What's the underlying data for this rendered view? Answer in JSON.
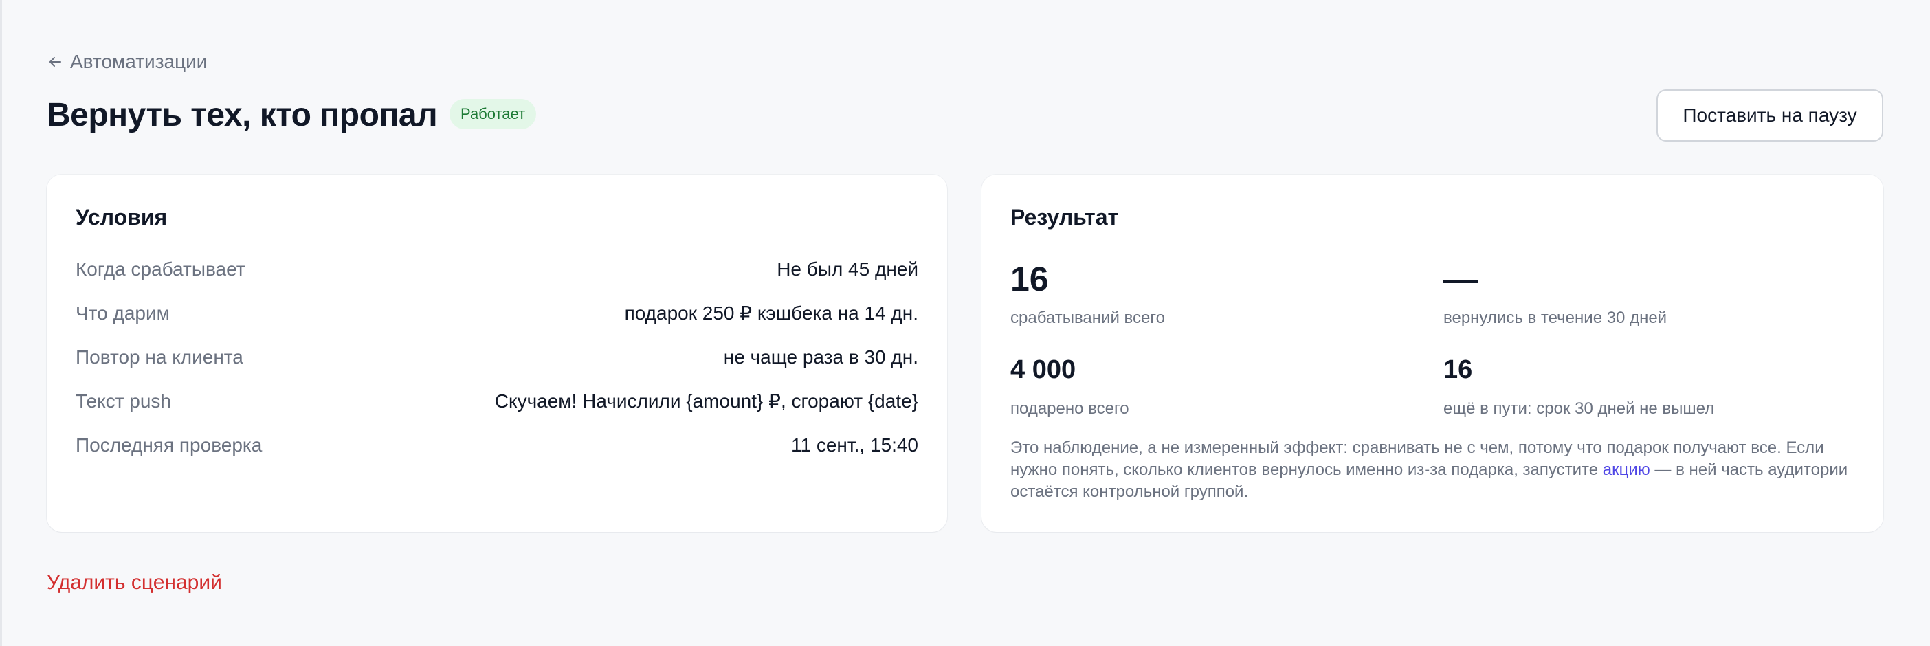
{
  "nav": {
    "back_label": "Автоматизации"
  },
  "header": {
    "title": "Вернуть тех, кто пропал",
    "status": "Работает",
    "pause_label": "Поставить на паузу"
  },
  "conditions": {
    "title": "Условия",
    "rows": [
      {
        "label": "Когда срабатывает",
        "value": "Не был 45 дней"
      },
      {
        "label": "Что дарим",
        "value": "подарок 250 ₽ кэшбека на 14 дн."
      },
      {
        "label": "Повтор на клиента",
        "value": "не чаще раза в 30 дн."
      },
      {
        "label": "Текст push",
        "value": "Скучаем! Начислили {amount} ₽, сгорают {date}"
      },
      {
        "label": "Последняя проверка",
        "value": "11 сент., 15:40"
      }
    ]
  },
  "result": {
    "title": "Результат",
    "metrics": [
      {
        "value": "16",
        "label": "срабатываний всего"
      },
      {
        "value": "—",
        "label": "вернулись в течение 30 дней"
      },
      {
        "value": "4 000",
        "label": "подарено всего"
      },
      {
        "value": "16",
        "label": "ещё в пути: срок 30 дней не вышел"
      }
    ],
    "note_before": "Это наблюдение, а не измеренный эффект: сравнивать не с чем, потому что подарок получают все. Если нужно понять, сколько клиентов вернулось именно из-за подарка, запустите ",
    "note_link": "акцию",
    "note_after": " — в ней часть аудитории остаётся контрольной группой."
  },
  "footer": {
    "delete_label": "Удалить сценарий"
  },
  "colors": {
    "status_bg": "#e3f7e8",
    "status_text": "#1d7a35",
    "link": "#4f46e5",
    "danger": "#d32f2f"
  }
}
